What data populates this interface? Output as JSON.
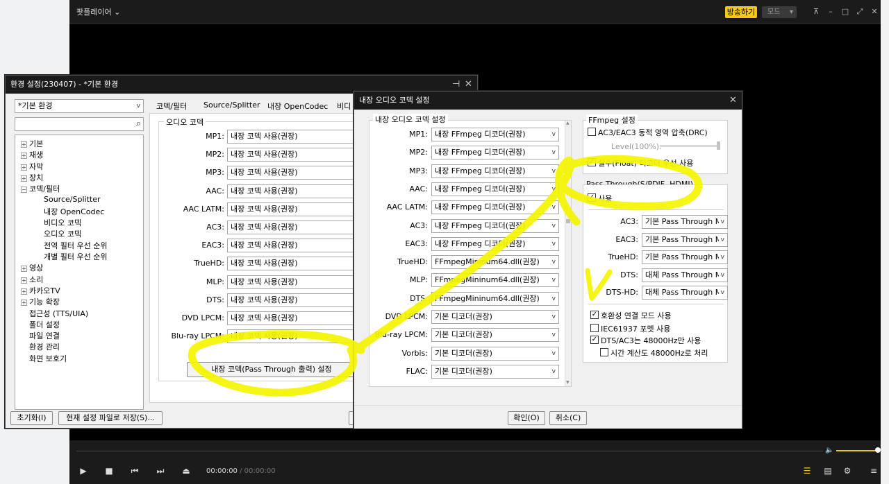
{
  "player": {
    "title": "팟플레이어",
    "broadcast": "방송하기",
    "mode": "모드",
    "time_current": "00:00:00",
    "time_sep": "/",
    "time_total": "00:00:00"
  },
  "settings": {
    "title": "환경 설정(230407) - *기본 환경",
    "profile": "*기본 환경",
    "tree": [
      "기본",
      "재생",
      "자막",
      "장치",
      "코덱/필터",
      "Source/Splitter",
      "내장 OpenCodec",
      "비디오 코덱",
      "오디오 코덱",
      "전역 필터 우선 순위",
      "개별 필터 우선 순위",
      "영상",
      "소리",
      "카카오TV",
      "기능 확장",
      "접근성 (TTS/UIA)",
      "폴더 설정",
      "파일 연결",
      "환경 관리",
      "화면 보호기"
    ],
    "tabs": [
      "코덱/필터",
      "Source/Splitter",
      "내장 OpenCodec",
      "비디"
    ],
    "group_title": "오디오 코덱",
    "codecs": [
      {
        "label": "MP1:",
        "value": "내장 코덱 사용(권장)"
      },
      {
        "label": "MP2:",
        "value": "내장 코덱 사용(권장)"
      },
      {
        "label": "MP3:",
        "value": "내장 코덱 사용(권장)"
      },
      {
        "label": "AAC:",
        "value": "내장 코덱 사용(권장)"
      },
      {
        "label": "AAC LATM:",
        "value": "내장 코덱 사용(권장)"
      },
      {
        "label": "AC3:",
        "value": "내장 코덱 사용(권장)"
      },
      {
        "label": "EAC3:",
        "value": "내장 코덱 사용(권장)"
      },
      {
        "label": "TrueHD:",
        "value": "내장 코덱 사용(권장)"
      },
      {
        "label": "MLP:",
        "value": "내장 코덱 사용(권장)"
      },
      {
        "label": "DTS:",
        "value": "내장 코덱 사용(권장)"
      },
      {
        "label": "DVD LPCM:",
        "value": "내장 코덱 사용(권장)"
      },
      {
        "label": "Blu-ray LPCM:",
        "value": "내장 코덱 사용(권장)"
      }
    ],
    "passthrough_button": "내장 코덱(Pass Through 출력) 설정",
    "reset_button": "초기화(I)",
    "save_button": "현재 설정 파일로 저장(S)..."
  },
  "audio_dialog": {
    "title": "내장 오디오 코덱 설정",
    "group_title": "내장 오디오 코덱 설정",
    "codecs": [
      {
        "label": "MP1:",
        "value": "내장 FFmpeg 디코더(권장)"
      },
      {
        "label": "MP2:",
        "value": "내장 FFmpeg 디코더(권장)"
      },
      {
        "label": "MP3:",
        "value": "내장 FFmpeg 디코더(권장)"
      },
      {
        "label": "AAC:",
        "value": "내장 FFmpeg 디코더(권장)"
      },
      {
        "label": "AAC LATM:",
        "value": "내장 FFmpeg 디코더(권장)"
      },
      {
        "label": "AC3:",
        "value": "내장 FFmpeg 디코더(권장)"
      },
      {
        "label": "EAC3:",
        "value": "내장 FFmpeg 디코더(권장)"
      },
      {
        "label": "TrueHD:",
        "value": "FFmpegMininum64.dll(권장)"
      },
      {
        "label": "MLP:",
        "value": "FFmpegMininum64.dll(권장)"
      },
      {
        "label": "DTS:",
        "value": "FFmpegMininum64.dll(권장)"
      },
      {
        "label": "DVD LPCM:",
        "value": "기본 디코더(권장)"
      },
      {
        "label": "Blu-ray LPCM:",
        "value": "기본 디코더(권장)"
      },
      {
        "label": "Vorbis:",
        "value": "기본 디코더(권장)"
      },
      {
        "label": "FLAC:",
        "value": "기본 디코더(권장)"
      }
    ],
    "ffmpeg_title": "FFmpeg 설정",
    "drc_label": "AC3/EAC3 동적 영역 압축(DRC)",
    "level_label": "Level(100%):",
    "float_label": "실수(Float) 디코더 우선 사용",
    "pt_title": "Pass Through(S/PDIF, HDMI)",
    "pt_use": "사용",
    "pt_rows": [
      {
        "label": "AC3:",
        "value": "기본 Pass Through M"
      },
      {
        "label": "EAC3:",
        "value": "기본 Pass Through M"
      },
      {
        "label": "TrueHD:",
        "value": "기본 Pass Through M"
      },
      {
        "label": "DTS:",
        "value": "대체 Pass Through M"
      },
      {
        "label": "DTS-HD:",
        "value": "대체 Pass Through M"
      }
    ],
    "compat_label": "호환성 연결 모드 사용",
    "iec_label": "IEC61937 포멧 사용",
    "dts48_label": "DTS/AC3는 48000Hz만 사용",
    "time48_label": "시간 계산도 48000Hz로 처리",
    "ok_button": "확인(O)",
    "cancel_button": "취소(C)"
  }
}
